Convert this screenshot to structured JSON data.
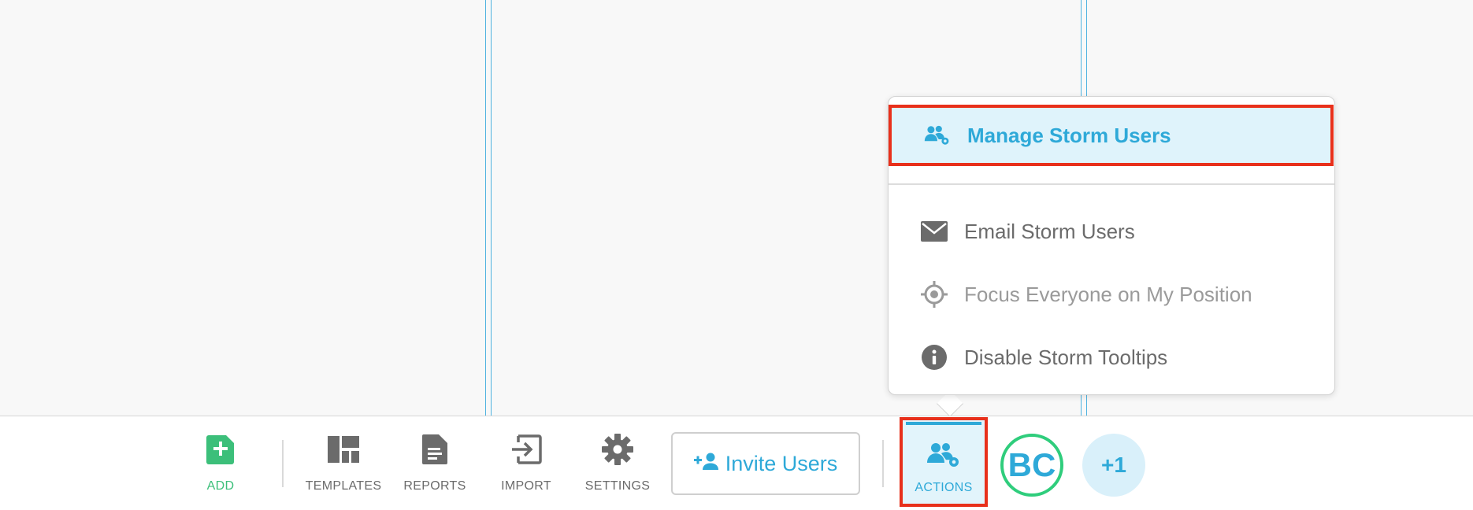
{
  "toolbar": {
    "add_label": "ADD",
    "templates_label": "TEMPLATES",
    "reports_label": "REPORTS",
    "import_label": "IMPORT",
    "settings_label": "SETTINGS",
    "invite_label": "Invite Users",
    "actions_label": "ACTIONS",
    "avatar_initials": "BC",
    "more_users_label": "+1"
  },
  "menu": {
    "items": [
      {
        "label": "Manage Storm Users",
        "icon": "users-gear-icon"
      },
      {
        "label": "Email Storm Users",
        "icon": "envelope-icon"
      },
      {
        "label": "Focus Everyone on My Position",
        "icon": "crosshair-icon"
      },
      {
        "label": "Disable Storm Tooltips",
        "icon": "info-icon"
      }
    ]
  },
  "colors": {
    "accent": "#2ea9d8",
    "add_green": "#3cbf7a",
    "highlight_red": "#e8301b",
    "selected_bg": "#dff3fb",
    "avatar_ring": "#2fcd7c"
  }
}
